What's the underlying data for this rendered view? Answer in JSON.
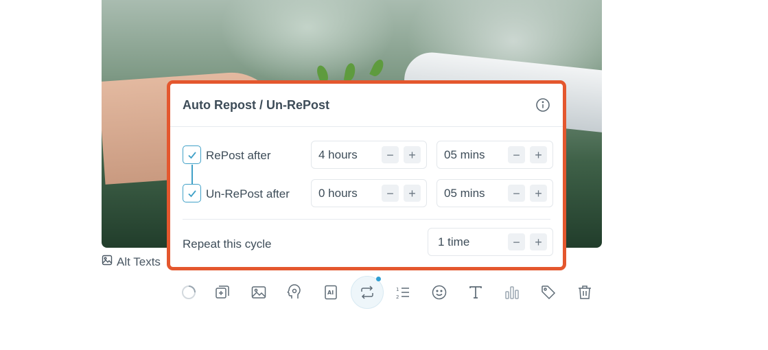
{
  "popup": {
    "title": "Auto Repost / Un-RePost",
    "info_icon": "info-icon",
    "repost": {
      "checked": true,
      "label": "RePost after",
      "hours": {
        "value": "4 hours",
        "minus": "−",
        "plus": "+"
      },
      "mins": {
        "value": "05 mins",
        "minus": "−",
        "plus": "+"
      }
    },
    "unrepost": {
      "checked": true,
      "label": "Un-RePost after",
      "hours": {
        "value": "0 hours",
        "minus": "−",
        "plus": "+"
      },
      "mins": {
        "value": "05 mins",
        "minus": "−",
        "plus": "+"
      }
    },
    "repeat": {
      "label": "Repeat this cycle",
      "value": "1 time",
      "minus": "−",
      "plus": "+"
    }
  },
  "alt_texts": {
    "label": "Alt Texts",
    "icon": "image-alt-icon"
  },
  "toolbar": {
    "tools": [
      "spinner-icon",
      "add-media-icon",
      "image-icon",
      "ai-brain-icon",
      "ai-text-icon",
      "repost-icon",
      "numbered-list-icon",
      "emoji-icon",
      "text-format-icon",
      "chart-icon",
      "tag-icon",
      "trash-icon"
    ],
    "active_tool": "repost-icon"
  },
  "colors": {
    "accent_border": "#e4572e",
    "checkbox": "#3fa0c7",
    "active_dot": "#2f9fd3"
  }
}
